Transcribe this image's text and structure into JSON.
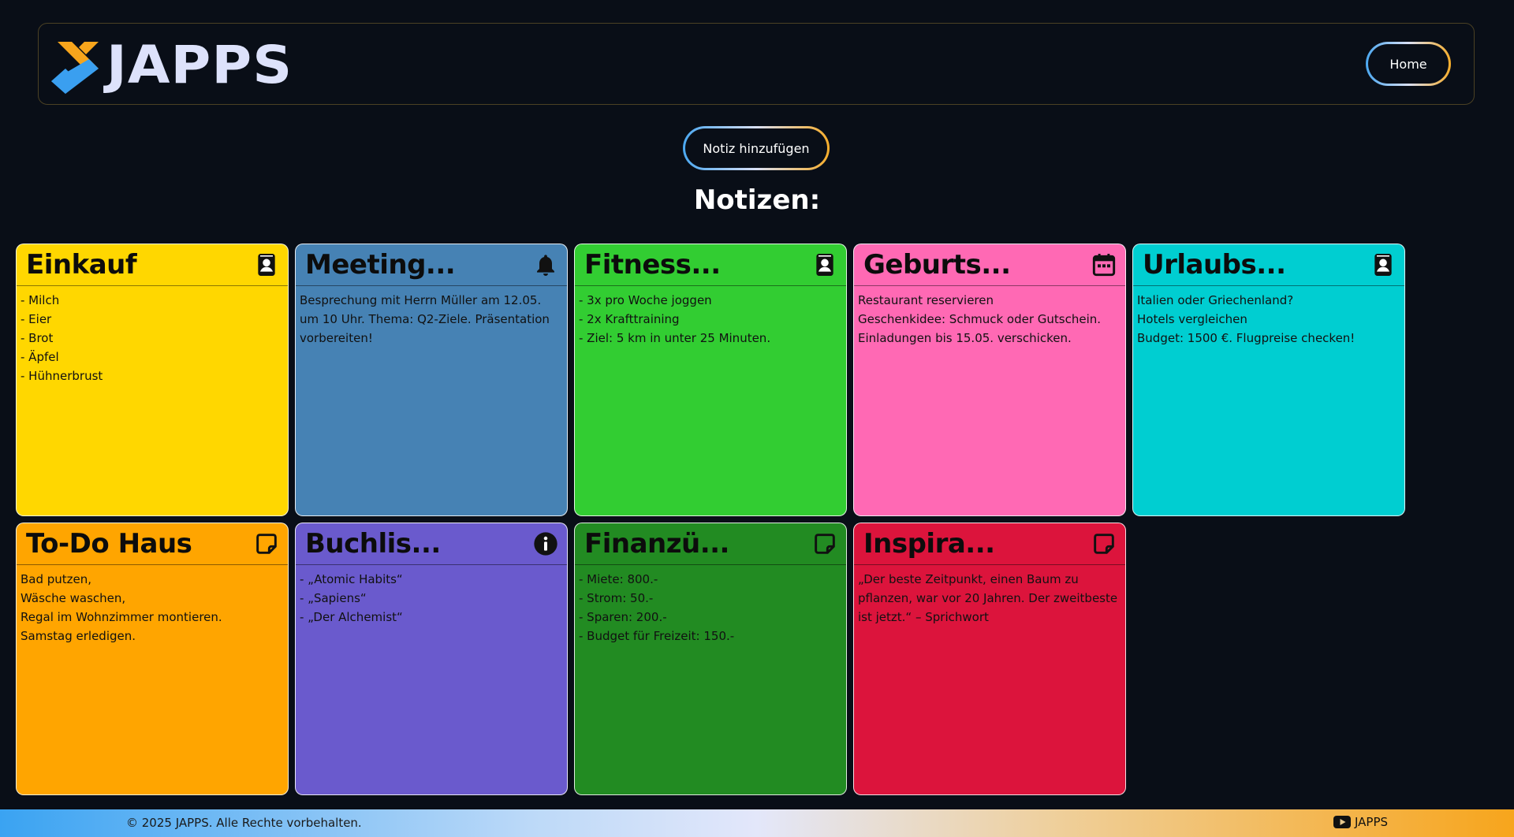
{
  "header": {
    "logo_text": "JAPPS",
    "home_label": "Home"
  },
  "actions": {
    "add_note_label": "Notiz hinzufügen"
  },
  "section_title": "Notizen:",
  "notes": [
    {
      "title": "Einkauf",
      "color": "#ffd700",
      "icon": "contact-icon",
      "lines": [
        "- Milch",
        "- Eier",
        "- Brot",
        "- Äpfel",
        "- Hühnerbrust"
      ]
    },
    {
      "title": "Meeting...",
      "color": "#4682b4",
      "icon": "bell-icon",
      "lines": [
        "Besprechung mit Herrn Müller am 12.05. um 10 Uhr. Thema: Q2-Ziele. Präsentation vorbereiten!"
      ]
    },
    {
      "title": "Fitness...",
      "color": "#32cd32",
      "icon": "contact-icon",
      "lines": [
        "- 3x pro Woche joggen",
        "- 2x Krafttraining",
        "- Ziel: 5 km in unter 25 Minuten."
      ]
    },
    {
      "title": "Geburts...",
      "color": "#ff69b4",
      "icon": "calendar-icon",
      "lines": [
        "Restaurant reservieren",
        "Geschenkidee: Schmuck oder Gutschein.",
        "Einladungen bis 15.05. verschicken."
      ]
    },
    {
      "title": "Urlaubs...",
      "color": "#00ced1",
      "icon": "contact-icon",
      "lines": [
        "Italien oder Griechenland?",
        "Hotels vergleichen",
        "Budget: 1500 €. Flugpreise checken!"
      ]
    },
    {
      "title": "To-Do Haus",
      "color": "#ffa500",
      "icon": "sticky-note-icon",
      "lines": [
        "Bad putzen,",
        "Wäsche waschen,",
        "Regal im Wohnzimmer montieren.",
        "Samstag erledigen."
      ]
    },
    {
      "title": "Buchlis...",
      "color": "#6a5acd",
      "icon": "info-icon",
      "lines": [
        "- „Atomic Habits“",
        "- „Sapiens“",
        "- „Der Alchemist“"
      ]
    },
    {
      "title": "Finanzü...",
      "color": "#228b22",
      "icon": "sticky-note-icon",
      "lines": [
        "- Miete: 800.-",
        "- Strom: 50.-",
        "- Sparen: 200.-",
        "- Budget für Freizeit: 150.-"
      ]
    },
    {
      "title": "Inspira...",
      "color": "#dc143c",
      "icon": "sticky-note-icon",
      "lines": [
        "„Der beste Zeitpunkt, einen Baum zu pflanzen, war vor 20 Jahren. Der zweitbeste ist jetzt.“ – Sprichwort"
      ]
    }
  ],
  "footer": {
    "copyright": "© 2025 JAPPS. Alle Rechte vorbehalten.",
    "link_label": "JAPPS",
    "link_icon": "youtube-icon"
  }
}
